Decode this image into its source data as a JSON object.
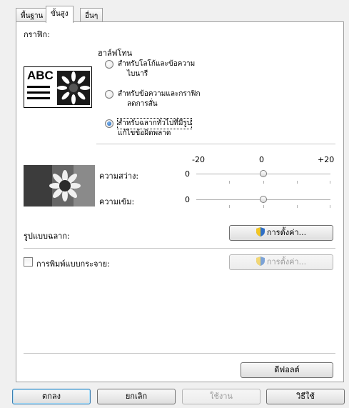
{
  "tabs": [
    "พื้นฐาน",
    "ขั้นสูง",
    "อื่นๆ"
  ],
  "graphics": {
    "label": "กราฟิก:",
    "halftone_label": "ฮาล์ฟโทน",
    "sample_text": "ABC",
    "options": [
      {
        "line1": "สำหรับโลโก้และข้อความ",
        "line2": "ไบนารี",
        "selected": false
      },
      {
        "line1": "สำหรับข้อความและกราฟิก",
        "line2": "ลดการสั่น",
        "selected": false
      },
      {
        "line1": "สำหรับฉลากทั่วไปที่มีรูป",
        "line2": "แก้ไขข้อผิดพลาด",
        "selected": true
      }
    ]
  },
  "adjust": {
    "scale_min": "-20",
    "scale_mid": "0",
    "scale_max": "+20",
    "brightness_label": "ความสว่าง:",
    "brightness_value": "0",
    "contrast_label": "ความเข้ม:",
    "contrast_value": "0",
    "brightness_level": 0,
    "contrast_level": 0
  },
  "label_format": {
    "label": "รูปแบบฉลาก:",
    "button": "การตั้งค่า..."
  },
  "distributed": {
    "label": "การพิมพ์แบบกระจาย:",
    "checked": false,
    "button": "การตั้งค่า..."
  },
  "default_button": "ดีฟอลต์",
  "footer": {
    "ok": "ตกลง",
    "cancel": "ยกเลิก",
    "apply": "ใช้งาน",
    "help": "วิธีใช้"
  },
  "colors": {
    "accent": "#1a5fb4",
    "shield_blue": "#2f6fc6",
    "shield_yellow": "#f3c623"
  }
}
